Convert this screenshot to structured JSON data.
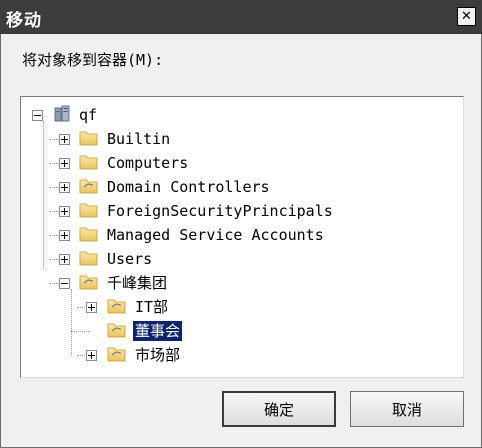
{
  "dialog": {
    "title": "移动",
    "close_label": "✕",
    "prompt": "将对象移到容器(M):"
  },
  "tree": {
    "root": {
      "label": "qf",
      "icon": "domain-server-icon"
    },
    "items": [
      {
        "label": "Builtin",
        "icon": "folder-icon",
        "expanded": false
      },
      {
        "label": "Computers",
        "icon": "folder-icon",
        "expanded": false
      },
      {
        "label": "Domain Controllers",
        "icon": "ou-folder-icon",
        "expanded": false
      },
      {
        "label": "ForeignSecurityPrincipals",
        "icon": "folder-icon",
        "expanded": false
      },
      {
        "label": "Managed Service Accounts",
        "icon": "folder-icon",
        "expanded": false
      },
      {
        "label": "Users",
        "icon": "folder-icon",
        "expanded": false
      },
      {
        "label": "千峰集团",
        "icon": "ou-folder-icon",
        "expanded": true,
        "children": [
          {
            "label": "IT部",
            "icon": "ou-folder-icon",
            "expanded": false
          },
          {
            "label": "董事会",
            "icon": "ou-folder-icon",
            "selected": true
          },
          {
            "label": "市场部",
            "icon": "ou-folder-icon",
            "expanded": false
          }
        ]
      }
    ]
  },
  "buttons": {
    "ok": "确定",
    "cancel": "取消"
  },
  "colors": {
    "selection": "#0a246a",
    "titlebar": "#3c3c3c",
    "folder": "#f3d57a"
  }
}
